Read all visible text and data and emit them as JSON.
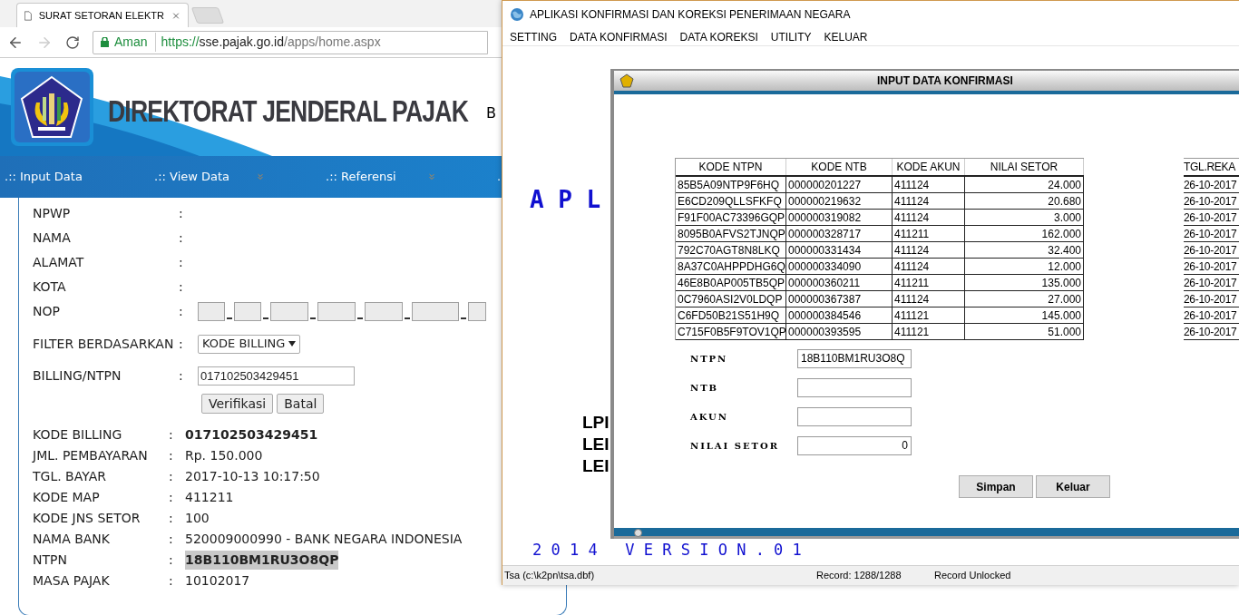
{
  "browser": {
    "tab_title": "SURAT SETORAN ELEKTR",
    "secure_label": "Aman",
    "url_scheme": "https://",
    "url_host": "sse.pajak.go.id",
    "url_path": "/apps/home.aspx",
    "header_title": "DIREKTORAT JENDERAL PAJAK",
    "header_cut_text": "B",
    "nav": [
      {
        "label": ".:: Input Data",
        "has_menu": false
      },
      {
        "label": ".:: View Data",
        "has_menu": true
      },
      {
        "label": ".:: Referensi",
        "has_menu": true
      },
      {
        "label": ".:"
      }
    ],
    "fields": [
      {
        "label": "NPWP",
        "separator": ":",
        "kind": "empty"
      },
      {
        "label": "NAMA",
        "separator": ":",
        "kind": "box"
      },
      {
        "label": "ALAMAT",
        "separator": ":",
        "kind": "box"
      },
      {
        "label": "KOTA",
        "separator": ":",
        "kind": "box"
      },
      {
        "label": "NOP",
        "separator": ":",
        "kind": "nop"
      },
      {
        "label": "FILTER BERDASARKAN",
        "separator": ":",
        "kind": "select",
        "value": "KODE BILLING"
      },
      {
        "label": "BILLING/NTPN",
        "separator": ":",
        "kind": "input",
        "value": "017102503429451"
      }
    ],
    "buttons": [
      "Verifikasi",
      "Batal"
    ],
    "result": [
      {
        "label": "KODE BILLING",
        "separator": ":",
        "value": "017102503429451",
        "bold": true,
        "highlighted": false
      },
      {
        "label": "JML. PEMBAYARAN",
        "separator": ":",
        "value": "Rp. 150.000",
        "bold": false,
        "highlighted": false
      },
      {
        "label": "TGL. BAYAR",
        "separator": ":",
        "value": "2017-10-13 10:17:50",
        "bold": false,
        "highlighted": false
      },
      {
        "label": "KODE MAP",
        "separator": ":",
        "value": "411211",
        "bold": false,
        "highlighted": false
      },
      {
        "label": "KODE JNS SETOR",
        "separator": ":",
        "value": "100",
        "bold": false,
        "highlighted": false
      },
      {
        "label": "NAMA BANK",
        "separator": ":",
        "value": "520009000990 - BANK NEGARA INDONESIA",
        "bold": false,
        "highlighted": false
      },
      {
        "label": "NTPN",
        "separator": ":",
        "value": "18B110BM1RU3O8QP",
        "bold": true,
        "highlighted": true
      },
      {
        "label": "MASA PAJAK",
        "separator": ":",
        "value": "10102017",
        "bold": false,
        "highlighted": false
      }
    ]
  },
  "app": {
    "title": "APLIKASI KONFIRMASI DAN KOREKSI PENERIMAAN NEGARA",
    "menu": [
      "SETTING",
      "DATA KONFIRMASI",
      "DATA KOREKSI",
      "UTILITY",
      "KELUAR"
    ],
    "background_heading": "A P L",
    "background_lines": [
      "LPI",
      "LEI",
      "LEI"
    ],
    "version": "2 0 1 4   V E R S I O N . 0 1",
    "dialog": {
      "title": "INPUT DATA KONFIRMASI",
      "columns": [
        "KODE NTPN",
        "KODE NTB",
        "KODE AKUN",
        "NILAI SETOR"
      ],
      "rows": [
        [
          "85B5A09NTP9F6HQ",
          "000000201227",
          "411124",
          "24.000"
        ],
        [
          "E6CD209QLLSFKFQ",
          "000000219632",
          "411124",
          "20.680"
        ],
        [
          "F91F00AC73396GQP",
          "000000319082",
          "411124",
          "3.000"
        ],
        [
          "8095B0AFVS2TJNQP",
          "000000328717",
          "411211",
          "162.000"
        ],
        [
          "792C70AGT8N8LKQ",
          "000000331434",
          "411124",
          "32.400"
        ],
        [
          "8A37C0AHPPDHG6Q",
          "000000334090",
          "411124",
          "12.000"
        ],
        [
          "46E8B0AP005TB5QP",
          "000000360211",
          "411211",
          "135.000"
        ],
        [
          "0C7960ASI2V0LDQP",
          "000000367387",
          "411124",
          "27.000"
        ],
        [
          "C6FD50B21S51H9Q",
          "000000384546",
          "411121",
          "145.000"
        ],
        [
          "C715F0B5F9TOV1QP",
          "000000393595",
          "411121",
          "51.000"
        ]
      ],
      "side_column": {
        "header": "TGL.REKA",
        "values": [
          "26-10-2017",
          "26-10-2017",
          "26-10-2017",
          "26-10-2017",
          "26-10-2017",
          "26-10-2017",
          "26-10-2017",
          "26-10-2017",
          "26-10-2017",
          "26-10-2017"
        ]
      },
      "fields": [
        {
          "label": "NTPN",
          "value": "18B110BM1RU3O8Q"
        },
        {
          "label": "NTB"
        },
        {
          "label": "AKUN"
        },
        {
          "label": "NILAI SETOR",
          "value": "0"
        }
      ],
      "buttons": [
        "Simpan",
        "Keluar"
      ]
    },
    "status_bar": [
      "Tsa (c:\\k2pn\\tsa.dbf)",
      "Record: 1288/1288",
      "Record Unlocked"
    ]
  }
}
